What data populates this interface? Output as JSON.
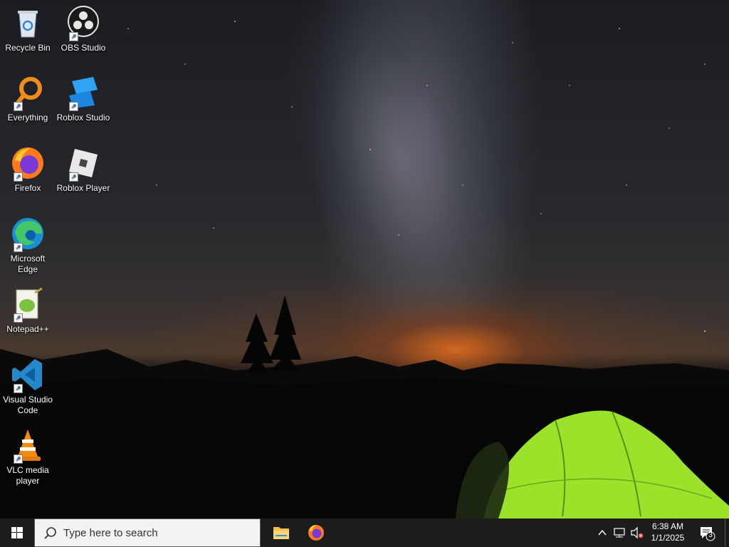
{
  "desktop": {
    "icons": [
      {
        "label": "Recycle Bin",
        "icon": "recycle-bin-icon"
      },
      {
        "label": "OBS Studio",
        "icon": "obs-studio-icon"
      },
      {
        "label": "Everything",
        "icon": "everything-search-icon"
      },
      {
        "label": "Roblox Studio",
        "icon": "roblox-studio-icon"
      },
      {
        "label": "Firefox",
        "icon": "firefox-icon"
      },
      {
        "label": "Roblox Player",
        "icon": "roblox-player-icon"
      },
      {
        "label": "Microsoft Edge",
        "icon": "edge-icon"
      },
      {
        "label": "Notepad++",
        "icon": "notepadplusplus-icon"
      },
      {
        "label": "Visual Studio Code",
        "icon": "vscode-icon"
      },
      {
        "label": "VLC media player",
        "icon": "vlc-icon"
      }
    ]
  },
  "taskbar": {
    "search_placeholder": "Type here to search",
    "pinned": [
      {
        "name": "File Explorer",
        "icon": "folder-icon"
      },
      {
        "name": "Firefox",
        "icon": "firefox-icon"
      }
    ],
    "clock_time": "6:38 AM",
    "clock_date": "1/1/2025",
    "notification_count": "3"
  },
  "colors": {
    "taskbar_bg": "#1c1c1c",
    "search_bg": "#f3f3f3",
    "tent_green": "#9be22a",
    "sunset_orange": "#e06a1e"
  }
}
